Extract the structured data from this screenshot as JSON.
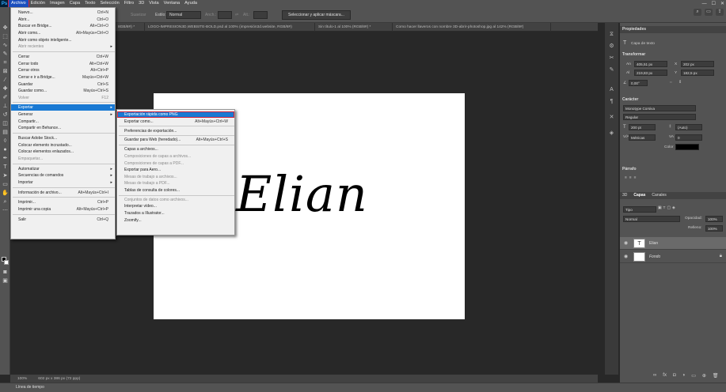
{
  "menubar": {
    "logo": "Ps",
    "items": [
      "Archivo",
      "Edición",
      "Imagen",
      "Capa",
      "Texto",
      "Selección",
      "Filtro",
      "3D",
      "Vista",
      "Ventana",
      "Ayuda"
    ],
    "window_controls": [
      "—",
      "☐",
      "✕"
    ]
  },
  "optionsbar": {
    "suavizar_label": "Suavizar",
    "estilo_label": "Estilo:",
    "estilo_value": "Normal",
    "anch_label": "Anch.:",
    "alt_label": "Alt.:",
    "mask_button": "Seleccionar y aplicar máscara..."
  },
  "tabs": [
    "8GB/8#) *",
    "LOGO-IMPRESION3D,WEBSITE-BOLD.psd al 100% (impresión3d.website, RGB/8#)",
    "Sin título-1 al 100% (RGB/8#) *",
    "Como hacer llaveros con nombre 3D-abrir-photoshop.jpg al 142% (RGB/8#)"
  ],
  "canvas": {
    "text": "Elian"
  },
  "statusbar": {
    "zoom": "100%",
    "doc_info": "602 px x 386 px (72 ppp)"
  },
  "timeline": {
    "label": "Línea de tiempo"
  },
  "archivo_menu": [
    {
      "label": "Nuevo...",
      "shortcut": "Ctrl+N"
    },
    {
      "label": "Abrir...",
      "shortcut": "Ctrl+O"
    },
    {
      "label": "Buscar en Bridge...",
      "shortcut": "Alt+Ctrl+O"
    },
    {
      "label": "Abrir como...",
      "shortcut": "Alt+Mayús+Ctrl+O"
    },
    {
      "label": "Abrir como objeto inteligente...",
      "shortcut": ""
    },
    {
      "label": "Abrir recientes",
      "shortcut": "",
      "submenu": true,
      "disabled": true
    },
    {
      "sep": true
    },
    {
      "label": "Cerrar",
      "shortcut": "Ctrl+W"
    },
    {
      "label": "Cerrar todo",
      "shortcut": "Alt+Ctrl+W"
    },
    {
      "label": "Cerrar otros",
      "shortcut": "Alt+Ctrl+P"
    },
    {
      "label": "Cerrar e ir a Bridge...",
      "shortcut": "Mayús+Ctrl+W"
    },
    {
      "label": "Guardar",
      "shortcut": "Ctrl+S"
    },
    {
      "label": "Guardar como...",
      "shortcut": "Mayús+Ctrl+S"
    },
    {
      "label": "Volver",
      "shortcut": "F12",
      "disabled": true
    },
    {
      "sep": true
    },
    {
      "label": "Exportar",
      "shortcut": "",
      "submenu": true,
      "highlighted": true
    },
    {
      "label": "Generar",
      "shortcut": "",
      "submenu": true
    },
    {
      "label": "Compartir...",
      "shortcut": ""
    },
    {
      "label": "Compartir en Behance...",
      "shortcut": ""
    },
    {
      "sep": true
    },
    {
      "label": "Buscar Adobe Stock...",
      "shortcut": ""
    },
    {
      "label": "Colocar elemento incrustado...",
      "shortcut": ""
    },
    {
      "label": "Colocar elementos enlazados...",
      "shortcut": ""
    },
    {
      "label": "Empaquetar...",
      "shortcut": "",
      "disabled": true
    },
    {
      "sep": true
    },
    {
      "label": "Automatizar",
      "shortcut": "",
      "submenu": true
    },
    {
      "label": "Secuencias de comandos",
      "shortcut": "",
      "submenu": true
    },
    {
      "label": "Importar",
      "shortcut": "",
      "submenu": true
    },
    {
      "sep": true
    },
    {
      "label": "Información de archivo...",
      "shortcut": "Alt+Mayús+Ctrl+I"
    },
    {
      "sep": true
    },
    {
      "label": "Imprimir...",
      "shortcut": "Ctrl+P"
    },
    {
      "label": "Imprimir una copia",
      "shortcut": "Alt+Mayús+Ctrl+P"
    },
    {
      "sep": true
    },
    {
      "label": "Salir",
      "shortcut": "Ctrl+Q"
    }
  ],
  "exportar_menu": [
    {
      "label": "Exportación rápida como PNG",
      "shortcut": "",
      "highlighted": true
    },
    {
      "label": "Exportar como...",
      "shortcut": "Alt+Mayús+Ctrl+W"
    },
    {
      "sep": true
    },
    {
      "label": "Preferencias de exportación...",
      "shortcut": ""
    },
    {
      "sep": true
    },
    {
      "label": "Guardar para Web (heredado)...",
      "shortcut": "Alt+Mayús+Ctrl+S"
    },
    {
      "sep": true
    },
    {
      "label": "Capas a archivos...",
      "shortcut": ""
    },
    {
      "label": "Composiciones de capas a archivos...",
      "shortcut": "",
      "disabled": true
    },
    {
      "label": "Composiciones de capas a PDF...",
      "shortcut": "",
      "disabled": true
    },
    {
      "label": "Exportar para Aero...",
      "shortcut": ""
    },
    {
      "label": "Mesas de trabajo a archivos...",
      "shortcut": "",
      "disabled": true
    },
    {
      "label": "Mesas de trabajo a PDF...",
      "shortcut": "",
      "disabled": true
    },
    {
      "label": "Tablas de consulta de colores...",
      "shortcut": ""
    },
    {
      "sep": true
    },
    {
      "label": "Conjuntos de datos como archivos...",
      "shortcut": "",
      "disabled": true
    },
    {
      "label": "Interpretar vídeo...",
      "shortcut": ""
    },
    {
      "label": "Trazados a Illustrator...",
      "shortcut": ""
    },
    {
      "label": "Zoomify...",
      "shortcut": ""
    }
  ],
  "properties": {
    "title": "Propiedades",
    "layer_type": "Capa de texto",
    "transform_title": "Transformar",
    "an_label": "An",
    "an_value": "405,51 px",
    "x_label": "X",
    "x_value": "202 px",
    "al_label": "Al",
    "al_value": "219,83 px",
    "y_label": "Y",
    "y_value": "182,5 px",
    "angle_value": "0,00°",
    "caracter_title": "Carácter",
    "font_family": "Monotype Corsiva",
    "font_style": "Regular",
    "font_size": "200 pt",
    "leading": "(Auto)",
    "kerning": "Métricas",
    "tracking": "0",
    "color_label": "Color",
    "parrafo_title": "Párrafo"
  },
  "layers": {
    "tabs": [
      "3D",
      "Capas",
      "Canales"
    ],
    "filter": "Tipo",
    "blend_mode": "Normal",
    "opacity_label": "Opacidad:",
    "opacity_value": "100%",
    "fill_label": "Relleno:",
    "fill_value": "100%",
    "items": [
      {
        "name": "Elian",
        "type": "text"
      },
      {
        "name": "Fondo",
        "type": "background"
      }
    ]
  }
}
